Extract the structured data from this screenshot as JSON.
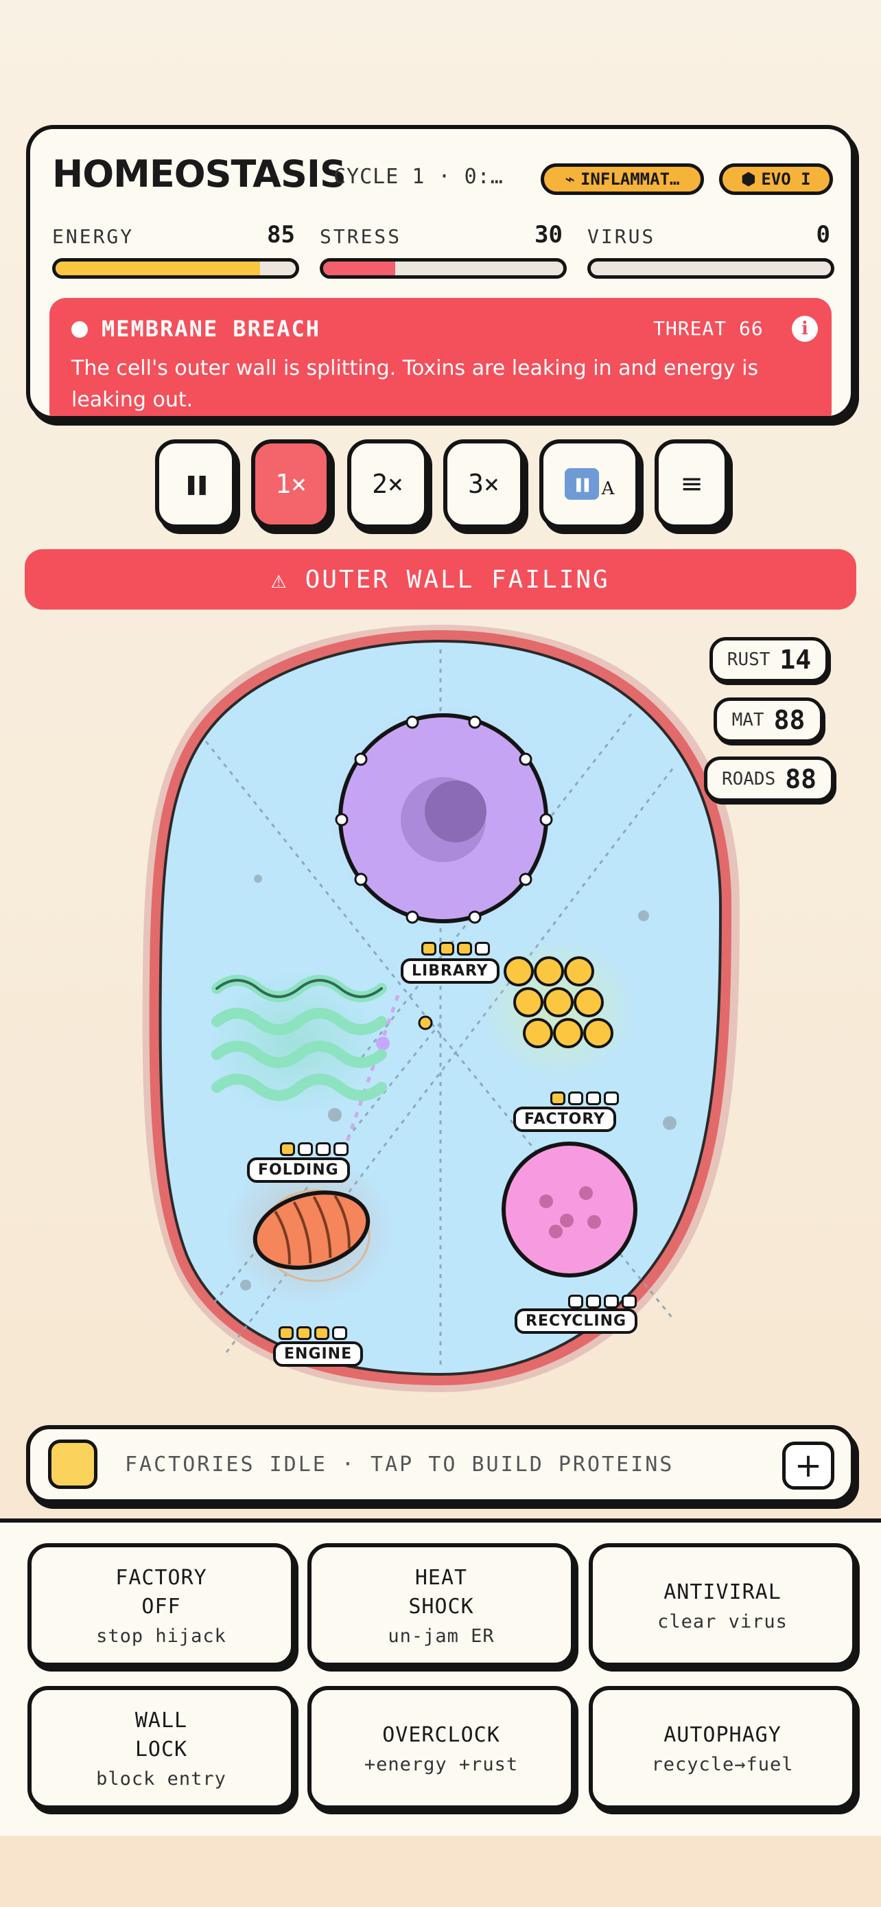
{
  "header": {
    "title": "HOMEOSTASIS",
    "cycle": "CYCLE 1 · 0:…",
    "inflammation_pill": "INFLAMMAT…",
    "inflammation_icon": "lightning-icon",
    "evo_pill": "EVO I",
    "evo_icon": "hexagon-icon"
  },
  "stats": [
    {
      "label": "ENERGY",
      "value": "85",
      "fraction": 0.85,
      "color": "#fcc740"
    },
    {
      "label": "STRESS",
      "value": "30",
      "fraction": 0.3,
      "color": "#f45f6d"
    },
    {
      "label": "VIRUS",
      "value": "0",
      "fraction": 0.0,
      "color": "#9b7cd9"
    }
  ],
  "alert": {
    "title": "MEMBRANE BREACH",
    "threat": "THREAT 66",
    "info": "i",
    "description": "The cell's outer wall is splitting. Toxins are leaking in and energy is leaking out."
  },
  "controls": {
    "pause": "❚❚",
    "speed1": "1×",
    "speed2": "2×",
    "speed3": "3×",
    "auto_suffix": "A",
    "menu": "≡",
    "selected_speed": "1×"
  },
  "banner": "⚠ OUTER WALL FAILING",
  "resources": [
    {
      "key": "RUST",
      "value": "14"
    },
    {
      "key": "MAT",
      "value": "88"
    },
    {
      "key": "ROADS",
      "value": "88"
    }
  ],
  "organelles": {
    "library": {
      "label": "LIBRARY",
      "level": 3,
      "max": 4
    },
    "factory": {
      "label": "FACTORY",
      "level": 1,
      "max": 4
    },
    "folding": {
      "label": "FOLDING",
      "level": 1,
      "max": 4
    },
    "recycling": {
      "label": "RECYCLING",
      "level": 0,
      "max": 4
    },
    "engine": {
      "label": "ENGINE",
      "level": 3,
      "max": 4
    }
  },
  "protein_bar": {
    "text": "FACTORIES IDLE · TAP TO BUILD PROTEINS",
    "add": "+",
    "swatch_color": "#fbd25c"
  },
  "actions": [
    {
      "title": "FACTORY\nOFF",
      "sub": "stop hijack"
    },
    {
      "title": "HEAT\nSHOCK",
      "sub": "un-jam ER"
    },
    {
      "title": "ANTIVIRAL",
      "sub": "clear virus"
    },
    {
      "title": "WALL\nLOCK",
      "sub": "block entry"
    },
    {
      "title": "OVERCLOCK",
      "sub": "+energy +rust"
    },
    {
      "title": "AUTOPHAGY",
      "sub": "recycle→fuel"
    }
  ]
}
